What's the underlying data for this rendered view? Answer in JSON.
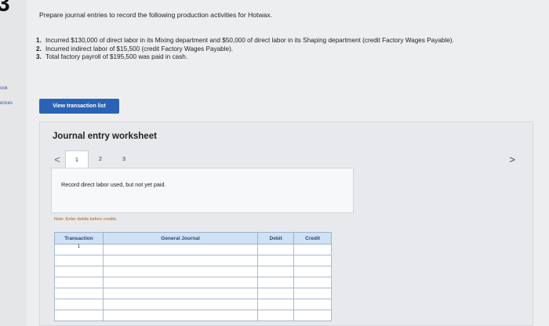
{
  "page": {
    "question_number": "3",
    "side_links": [
      "ook",
      "ences"
    ],
    "prompt": "Prepare journal entries to record the following production activities for Hotwax."
  },
  "steps": [
    {
      "num": "1.",
      "text": "Incurred $130,000 of direct labor in its Mixing department and $50,000 of direct labor in its Shaping department (credit Factory Wages Payable)."
    },
    {
      "num": "2.",
      "text": "Incurred indirect labor of $15,500 (credit Factory Wages Payable)."
    },
    {
      "num": "3.",
      "text": "Total factory payroll of $195,500 was paid in cash."
    }
  ],
  "buttons": {
    "view_transaction_list": "View transaction list"
  },
  "worksheet": {
    "title": "Journal entry worksheet",
    "prev_arrow": "<",
    "next_arrow": ">",
    "tabs": [
      "1",
      "2",
      "3"
    ],
    "active_tab": 0,
    "description": "Record direct labor used, but not yet paid.",
    "note": "Note: Enter debits before credits."
  },
  "journal_table": {
    "headers": {
      "transaction": "Transaction",
      "general_journal": "General Journal",
      "debit": "Debit",
      "credit": "Credit"
    },
    "rows": [
      {
        "transaction": "1",
        "account": "",
        "debit": "",
        "credit": ""
      },
      {
        "transaction": "",
        "account": "",
        "debit": "",
        "credit": ""
      },
      {
        "transaction": "",
        "account": "",
        "debit": "",
        "credit": ""
      },
      {
        "transaction": "",
        "account": "",
        "debit": "",
        "credit": ""
      },
      {
        "transaction": "",
        "account": "",
        "debit": "",
        "credit": ""
      },
      {
        "transaction": "",
        "account": "",
        "debit": "",
        "credit": ""
      },
      {
        "transaction": "",
        "account": "",
        "debit": "",
        "credit": ""
      }
    ]
  },
  "colors": {
    "button_blue": "#2a63b6",
    "table_header": "#cfe1f3",
    "note_orange": "#b06010"
  }
}
